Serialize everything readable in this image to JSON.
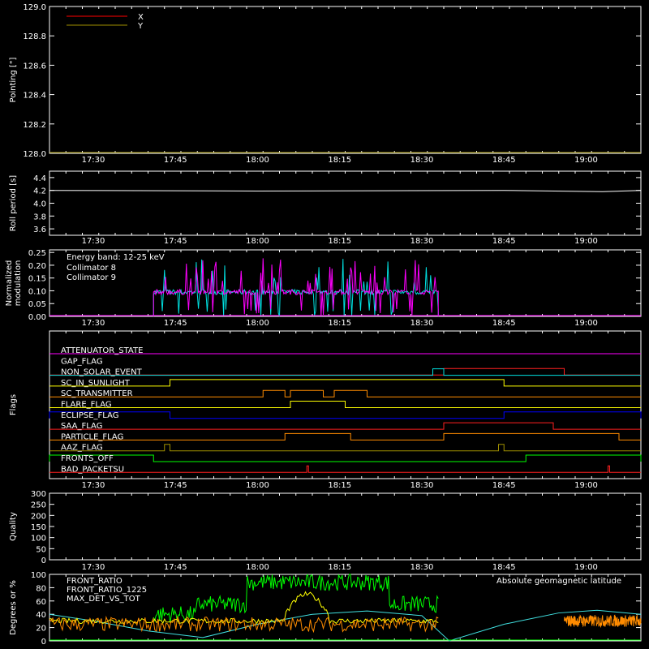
{
  "colors": {
    "background": "#000000",
    "axes": "#ffffff",
    "x_pointing": "#ff0000",
    "y_pointing": "#a09000",
    "collimator8": "#00e0e0",
    "collimator9": "#ff00ff",
    "front_ratio": "#ffff00",
    "front_ratio_1225": "#00ff00",
    "max_det": "#ff8c00",
    "geomag": "#40e0e0"
  },
  "time_axis": {
    "start": "17:22",
    "end": "19:10",
    "tick_labels": [
      "17:30",
      "17:45",
      "18:00",
      "18:15",
      "18:30",
      "18:45",
      "19:00"
    ]
  },
  "chart_data": [
    {
      "id": "pointing",
      "type": "line",
      "ylabel": "Pointing [\"]",
      "ylim": [
        128.0,
        129.0
      ],
      "yticks": [
        "128.0",
        "128.2",
        "128.4",
        "128.6",
        "128.8",
        "129.0"
      ],
      "legend": [
        {
          "name": "X",
          "color": "#ff0000"
        },
        {
          "name": "Y",
          "color": "#a09000"
        }
      ],
      "series": [
        {
          "name": "Y",
          "x": [
            "17:22",
            "19:10"
          ],
          "y": [
            128.0,
            128.0
          ]
        }
      ]
    },
    {
      "id": "roll",
      "type": "line",
      "ylabel": "Roll period [s]",
      "ylim": [
        3.5,
        4.5
      ],
      "yticks": [
        "3.6",
        "3.8",
        "4.0",
        "4.2",
        "4.4"
      ],
      "series": [
        {
          "name": "roll",
          "x": [
            "17:22",
            "18:00",
            "18:45",
            "19:03",
            "19:10"
          ],
          "y": [
            4.2,
            4.19,
            4.2,
            4.18,
            4.2
          ]
        }
      ]
    },
    {
      "id": "modulation",
      "type": "line",
      "ylabel": "Normalized\nmodulation",
      "ylim": [
        0,
        0.26
      ],
      "yticks": [
        "0.00",
        "0.05",
        "0.10",
        "0.15",
        "0.20",
        "0.25"
      ],
      "energy_band": "Energy band: 12-25 keV",
      "legend": [
        {
          "name": "Collimator 8",
          "color": "#00e0e0"
        },
        {
          "name": "Collimator 9",
          "color": "#ff00ff"
        }
      ],
      "active_range": [
        "17:41",
        "18:33"
      ],
      "baseline": 0.095
    },
    {
      "id": "flags",
      "type": "line",
      "ylabel": "Flags",
      "flags": [
        {
          "name": "ATTENUATOR_STATE",
          "color": "#ff00ff",
          "segments": []
        },
        {
          "name": "GAP_FLAG",
          "color": "#ff2020",
          "segments": [
            [
              "18:34",
              "18:56"
            ],
            [
              "18:56",
              "19:10"
            ]
          ],
          "levels": [
            1,
            0
          ]
        },
        {
          "name": "NON_SOLAR_EVENT",
          "color": "#00e0e0",
          "segments": [
            [
              "18:32",
              "18:34"
            ]
          ]
        },
        {
          "name": "SC_IN_SUNLIGHT",
          "color": "#ffff00",
          "segments": [
            [
              "17:44",
              "18:45"
            ]
          ]
        },
        {
          "name": "SC_TRANSMITTER",
          "color": "#ff8c00",
          "segments": [
            [
              "18:01",
              "18:05"
            ],
            [
              "18:06",
              "18:12"
            ],
            [
              "18:14",
              "18:20"
            ]
          ]
        },
        {
          "name": "FLARE_FLAG",
          "color": "#ffff00",
          "segments": [
            [
              "18:06",
              "18:16"
            ]
          ]
        },
        {
          "name": "ECLIPSE_FLAG",
          "color": "#0000ff",
          "segments": [
            [
              "17:22",
              "17:44"
            ],
            [
              "18:45",
              "19:10"
            ]
          ]
        },
        {
          "name": "SAA_FLAG",
          "color": "#ff2020",
          "segments": [
            [
              "18:34",
              "18:54"
            ]
          ]
        },
        {
          "name": "PARTICLE_FLAG",
          "color": "#ff8c00",
          "segments": [
            [
              "18:05",
              "18:17"
            ],
            [
              "18:34",
              "19:06"
            ]
          ]
        },
        {
          "name": "AAZ_FLAG",
          "color": "#a09000",
          "segments": [
            [
              "17:43",
              "17:44"
            ],
            [
              "18:44",
              "18:45"
            ]
          ]
        },
        {
          "name": "FRONTS_OFF",
          "color": "#00ff00",
          "segments": [
            [
              "17:22",
              "17:41"
            ],
            [
              "18:49",
              "19:10"
            ]
          ]
        },
        {
          "name": "BAD_PACKETSU",
          "color": "#ff2020",
          "segments": [
            [
              "18:09",
              "18:09"
            ],
            [
              "19:04",
              "19:04"
            ]
          ]
        }
      ]
    },
    {
      "id": "quality",
      "type": "line",
      "ylabel": "Quality",
      "ylim": [
        0,
        300
      ],
      "yticks": [
        "0",
        "50",
        "100",
        "150",
        "200",
        "250",
        "300"
      ],
      "series": []
    },
    {
      "id": "ratios",
      "type": "line",
      "ylabel": "Degrees or %",
      "ylim": [
        0,
        100
      ],
      "yticks": [
        "0",
        "20",
        "40",
        "60",
        "80",
        "100"
      ],
      "legend": [
        {
          "name": "FRONT_RATIO",
          "color": "#ffff00"
        },
        {
          "name": "FRONT_RATIO_1225",
          "color": "#00ff00"
        },
        {
          "name": "MAX_DET_VS_TOT",
          "color": "#ff8c00"
        }
      ],
      "annotation": "Absolute geomagnetic latitude",
      "series": [
        {
          "name": "Absolute geomagnetic latitude",
          "x": [
            "17:22",
            "17:30",
            "17:40",
            "17:50",
            "18:00",
            "18:10",
            "18:20",
            "18:30",
            "18:35",
            "18:45",
            "18:55",
            "19:02",
            "19:10"
          ],
          "y": [
            40,
            30,
            15,
            5,
            25,
            40,
            45,
            38,
            0,
            25,
            42,
            46,
            40
          ]
        }
      ]
    }
  ]
}
